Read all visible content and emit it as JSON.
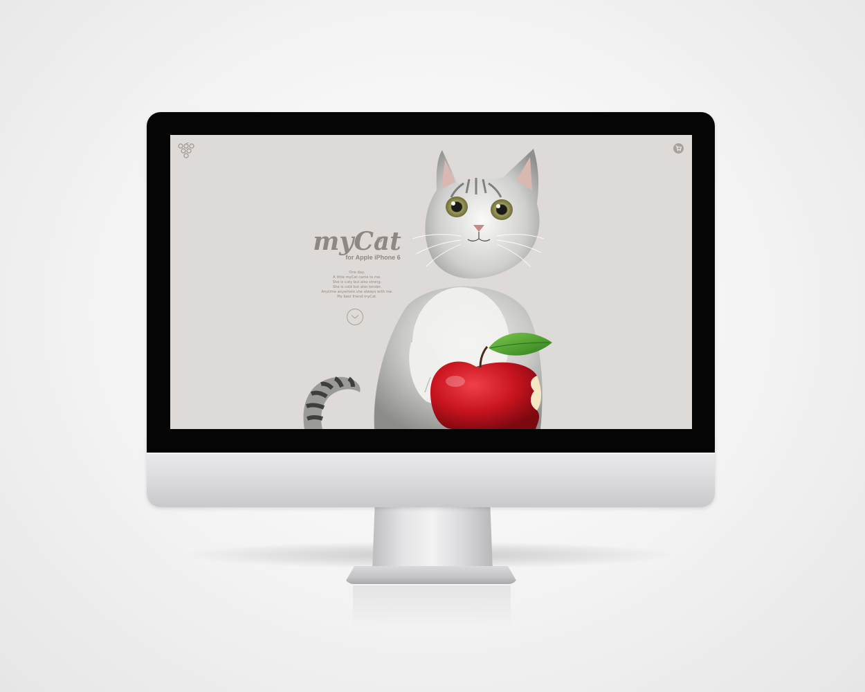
{
  "header": {
    "logo_icon": "grape-cluster-icon",
    "cart_icon": "shopping-cart-icon"
  },
  "hero": {
    "title": "myCat",
    "registered_mark": "®",
    "subtitle": "for Apple iPhone 6",
    "story_lines": [
      "One day,",
      "A little myCat came to me.",
      "She is cuty but also strong.",
      "She is cold but also tender.",
      "Anytime anywhere she always with me.",
      "My best friend myCat."
    ],
    "scroll_icon": "chevron-down-icon"
  },
  "colors": {
    "page_background": "#dedad7",
    "text": "#8d8884",
    "apple_red": "#c8141e",
    "leaf_green": "#4fa830",
    "bezel": "#050505"
  }
}
